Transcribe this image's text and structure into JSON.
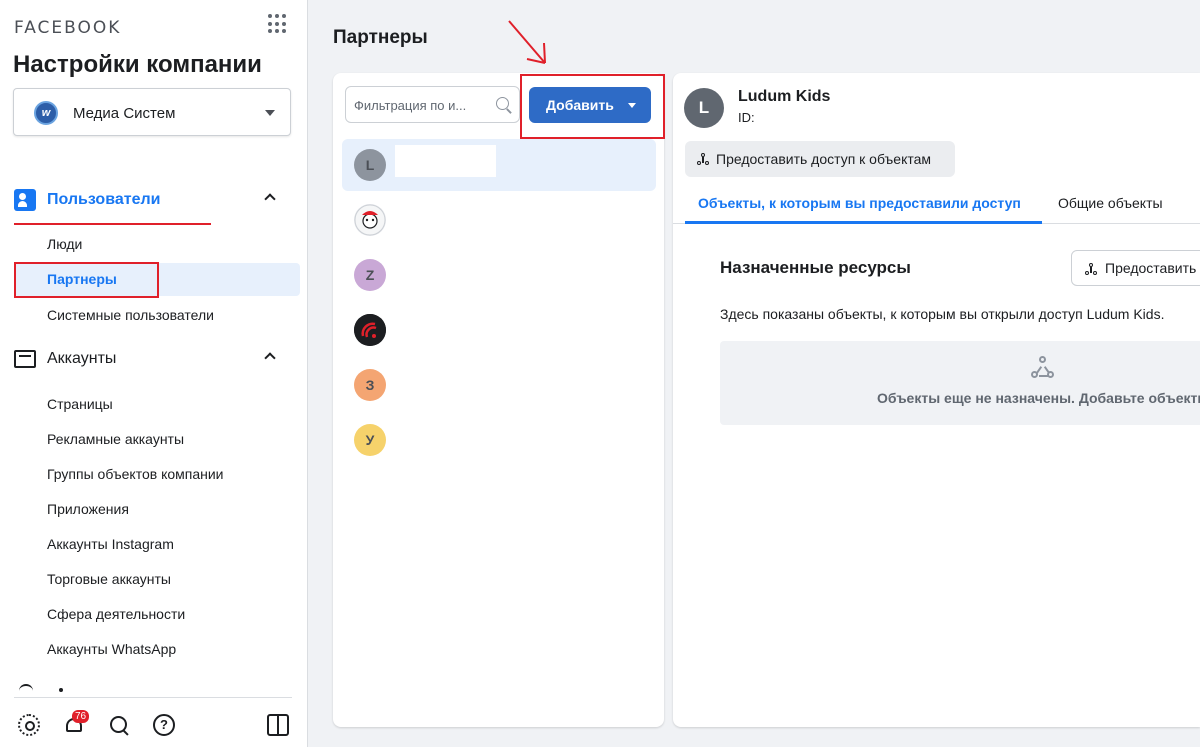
{
  "sidebar": {
    "brand": "FACEBOOK",
    "heading": "Настройки компании",
    "company": {
      "logo_text": "w",
      "name": "Медиа Систем"
    },
    "users_section": {
      "label": "Пользователи",
      "items": [
        "Люди",
        "Партнеры",
        "Системные пользователи"
      ]
    },
    "accounts_section": {
      "label": "Аккаунты",
      "items": [
        "Страницы",
        "Рекламные аккаунты",
        "Группы объектов компании",
        "Приложения",
        "Аккаунты Instagram",
        "Торговые аккаунты",
        "Сфера деятельности",
        "Аккаунты WhatsApp"
      ]
    },
    "notification_count": "76",
    "help_glyph": "?"
  },
  "main": {
    "title": "Партнеры",
    "filter_placeholder": "Фильтрация по и...",
    "add_button": "Добавить",
    "partners": [
      {
        "initial": "L",
        "bg": "#8d949e"
      },
      {
        "initial": "",
        "bg": "#e4e6eb"
      },
      {
        "initial": "Z",
        "bg": "#c9a8d6"
      },
      {
        "initial": "",
        "bg": "#1c1e21"
      },
      {
        "initial": "З",
        "bg": "#f4a572"
      },
      {
        "initial": "У",
        "bg": "#f6d26b"
      }
    ]
  },
  "detail": {
    "avatar_initial": "L",
    "name": "Ludum Kids",
    "id_label": "ID:",
    "share_button": "Предоставить доступ к объектам",
    "tab_active": "Объекты, к которым вы предоставили доступ",
    "tab_other": "Общие объекты",
    "resources_title": "Назначенные ресурсы",
    "share_button_2": "Предоставить",
    "description": "Здесь показаны объекты, к которым вы открыли доступ Ludum Kids.",
    "empty_text": "Объекты еще не назначены. Добавьте объекты"
  },
  "colors": {
    "accent": "#1877f2",
    "add_button": "#2e6bc6",
    "annotation_red": "#e0202a"
  }
}
